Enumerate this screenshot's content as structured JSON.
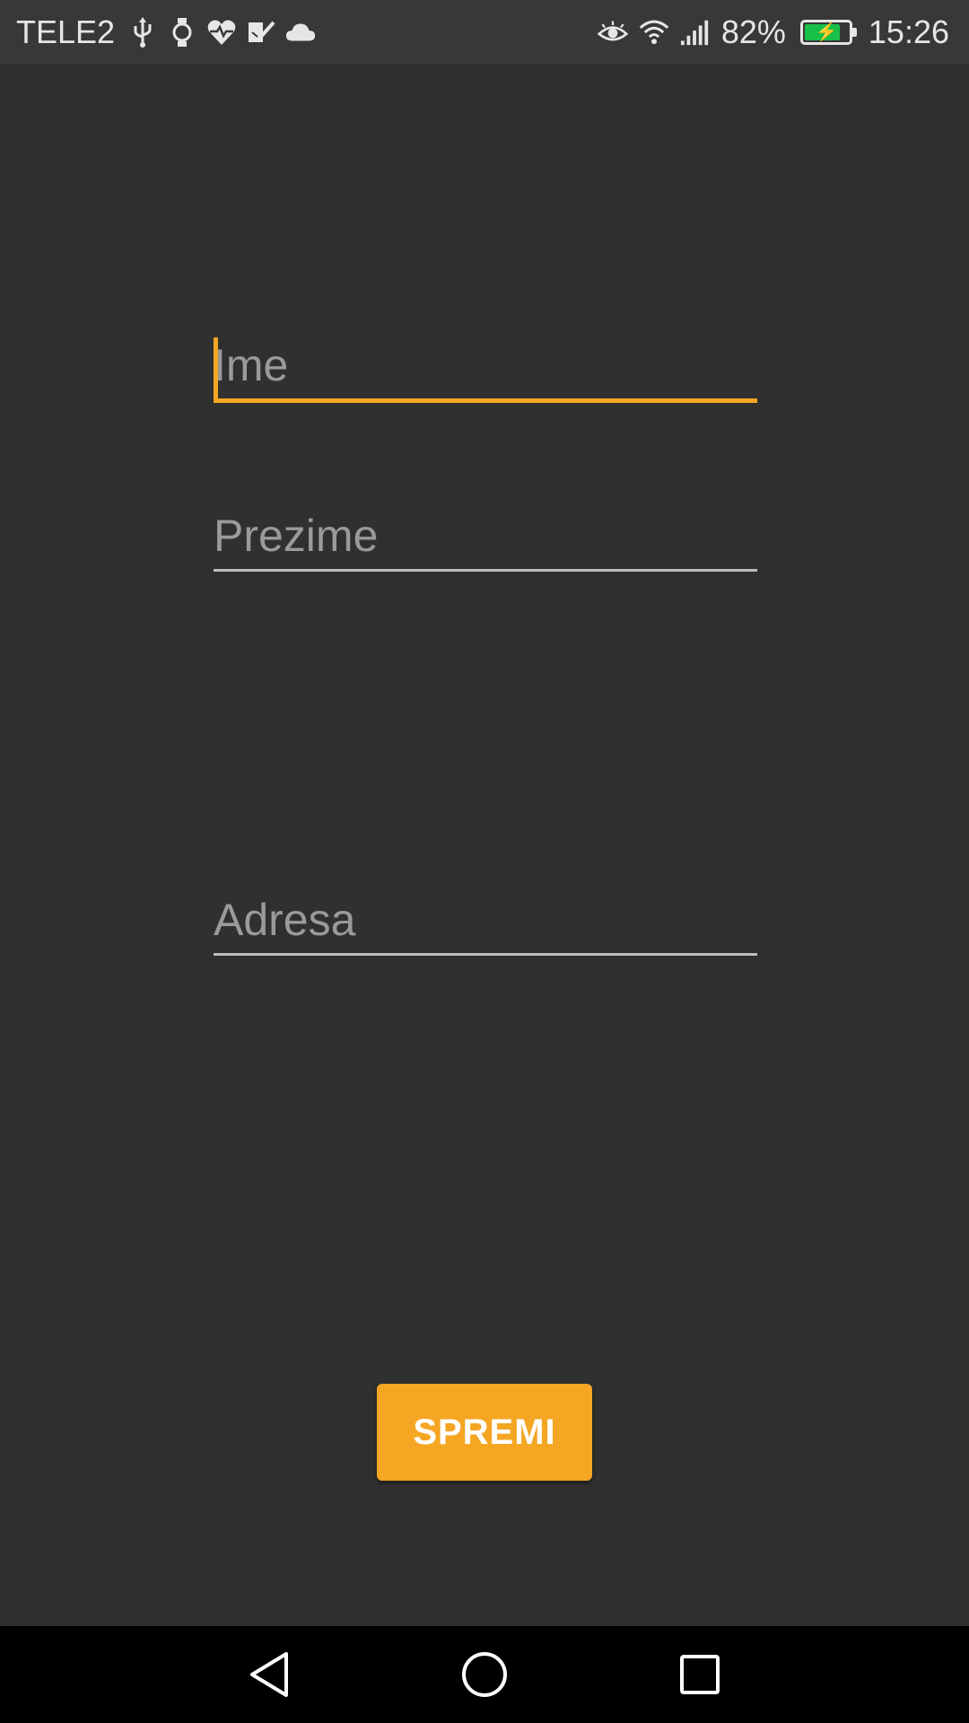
{
  "status_bar": {
    "carrier": "TELE2",
    "icons_left": [
      "usb-icon",
      "watch-icon",
      "heart-rate-icon",
      "task-check-icon",
      "cloud-icon"
    ],
    "icons_right": [
      "eye-icon",
      "wifi-icon",
      "signal-icon"
    ],
    "battery_percent": "82%",
    "battery_level": 0.82,
    "battery_charging": true,
    "time": "15:26"
  },
  "form": {
    "first_name": {
      "placeholder": "Ime",
      "value": "",
      "focused": true
    },
    "last_name": {
      "placeholder": "Prezime",
      "value": ""
    },
    "address": {
      "placeholder": "Adresa",
      "value": ""
    }
  },
  "actions": {
    "save_label": "SPREMI"
  },
  "nav": {
    "icons": [
      "back-icon",
      "home-icon",
      "recent-apps-icon"
    ]
  },
  "colors": {
    "accent": "#f5a623",
    "background": "#303030",
    "status_bar": "#383838",
    "nav_bar": "#000000",
    "battery": "#18c04a"
  }
}
